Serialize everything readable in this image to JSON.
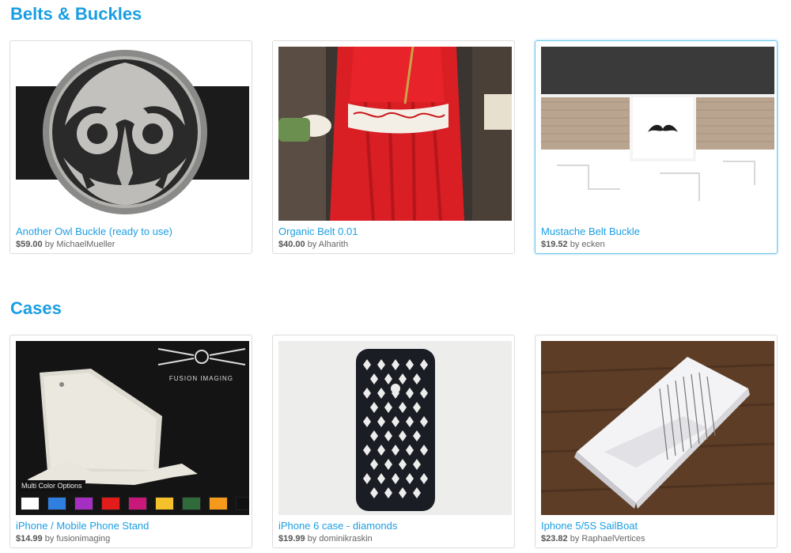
{
  "sections": [
    {
      "title": "Belts & Buckles",
      "items": [
        {
          "title": "Another Owl Buckle (ready to use)",
          "price": "$59.00",
          "by": "by",
          "author": "MichaelMueller"
        },
        {
          "title": "Organic Belt 0.01",
          "price": "$40.00",
          "by": "by",
          "author": "Alharith"
        },
        {
          "title": "Mustache Belt Buckle",
          "price": "$19.52",
          "by": "by",
          "author": "ecken"
        }
      ]
    },
    {
      "title": "Cases",
      "items": [
        {
          "title": "iPhone / Mobile Phone Stand",
          "price": "$14.99",
          "by": "by",
          "author": "fusionimaging",
          "image_label": "Multi Color Options",
          "brand_label": "FUSION IMAGING"
        },
        {
          "title": "iPhone 6 case - diamonds",
          "price": "$19.99",
          "by": "by",
          "author": "dominikraskin"
        },
        {
          "title": "Iphone 5/5S SailBoat",
          "price": "$23.82",
          "by": "by",
          "author": "RaphaelVertices"
        }
      ]
    }
  ],
  "color_options": [
    "#ffffff",
    "#2f7fe0",
    "#a52fc2",
    "#e21b1b",
    "#c8197a",
    "#f5c12b",
    "#2e6a3a",
    "#f59a1a",
    "#111111"
  ],
  "colors": {
    "accent": "#1a9ee3",
    "highlight_border": "#6cc9f0"
  }
}
